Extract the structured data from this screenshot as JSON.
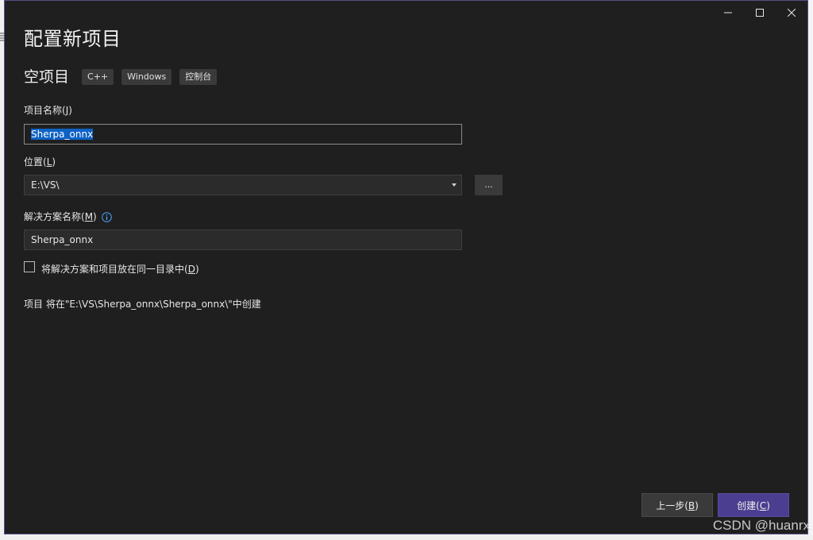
{
  "background": {
    "edge_char": "目"
  },
  "window": {
    "controls": {
      "minimize_icon": "minimize-icon",
      "maximize_icon": "maximize-icon",
      "close_icon": "close-icon"
    },
    "title": "配置新项目",
    "template": {
      "name": "空项目",
      "tags": [
        "C++",
        "Windows",
        "控制台"
      ]
    },
    "project_name": {
      "label_prefix": "项目名称(",
      "label_key": "J",
      "label_suffix": ")",
      "value": "Sherpa_onnx"
    },
    "location": {
      "label_prefix": "位置(",
      "label_key": "L",
      "label_suffix": ")",
      "value": "E:\\VS\\",
      "browse_label": "..."
    },
    "solution_name": {
      "label_prefix": "解决方案名称(",
      "label_key": "M",
      "label_suffix": ")",
      "value": "Sherpa_onnx"
    },
    "same_dir_checkbox": {
      "label_prefix": "将解决方案和项目放在同一目录中(",
      "label_key": "D",
      "label_suffix": ")",
      "checked": false
    },
    "path_info": "项目 将在\"E:\\VS\\Sherpa_onnx\\Sherpa_onnx\\\"中创建",
    "buttons": {
      "back_prefix": "上一步(",
      "back_key": "B",
      "back_suffix": ")",
      "create_prefix": "创建(",
      "create_key": "C",
      "create_suffix": ")"
    },
    "colors": {
      "window_bg": "#1f1f1f",
      "accent": "#4b3d8f",
      "selection": "#0e62c4"
    }
  },
  "watermark": "CSDN @huanrx"
}
